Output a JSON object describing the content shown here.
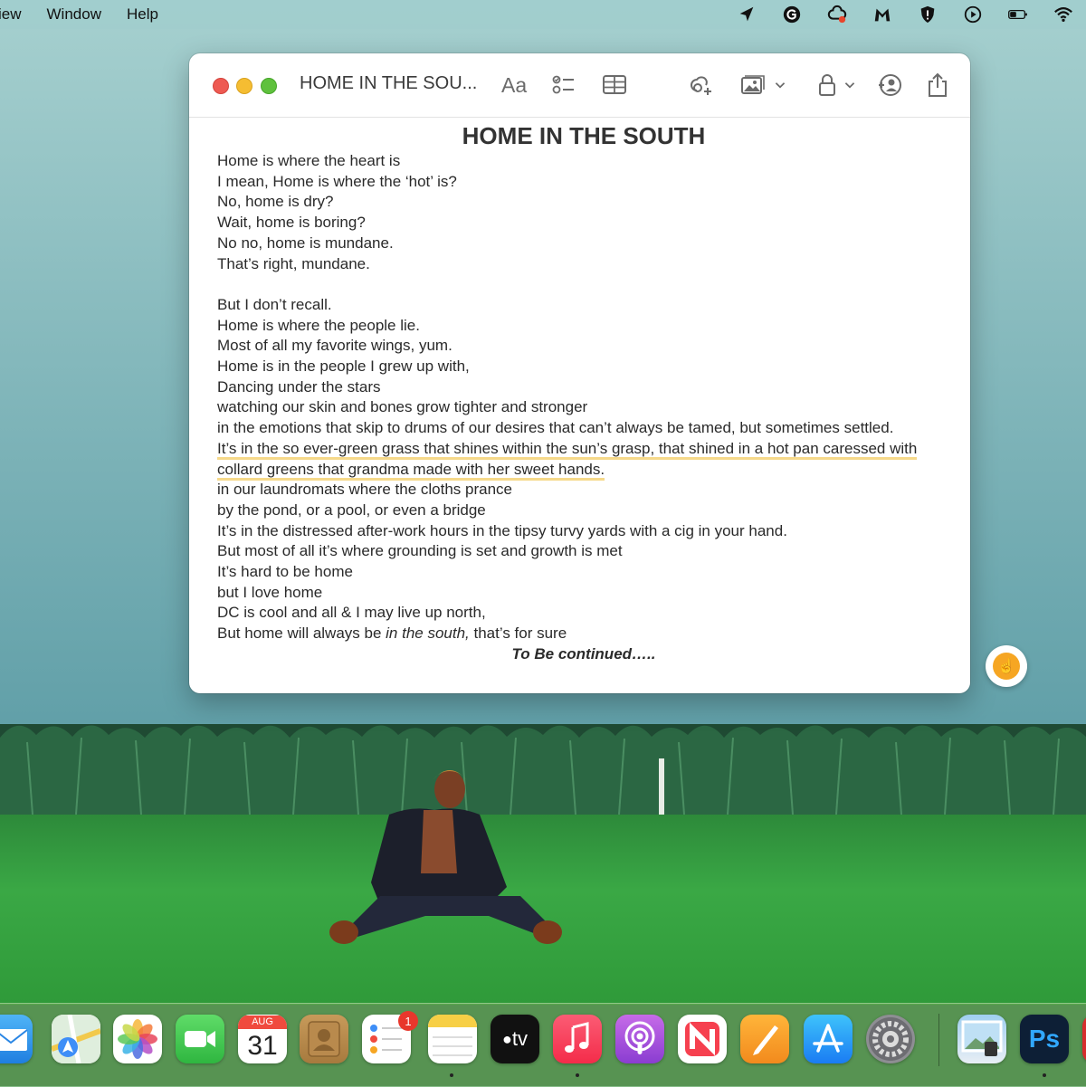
{
  "menubar": {
    "items": [
      "iew",
      "Window",
      "Help"
    ],
    "right_icons": [
      "location-arrow-icon",
      "grammarly-icon",
      "creative-cloud-icon",
      "malwarebytes-icon",
      "shield-icon",
      "play-circle-icon",
      "battery-icon",
      "wifi-icon"
    ]
  },
  "window": {
    "title": "HOME IN THE SOU...",
    "format_label": "Aa",
    "toolbar_icons": [
      "checklist-icon",
      "table-icon",
      "collaborate-icon",
      "media-icon",
      "lock-icon",
      "share-people-icon",
      "share-icon"
    ]
  },
  "note": {
    "heading": "HOME IN THE SOUTH",
    "lines": [
      "Home is where the heart is",
      "I mean, Home is where the ‘hot’ is?",
      "No, home is dry?",
      "Wait, home is boring?",
      "No no, home is mundane.",
      "That’s right, mundane.",
      "",
      "But I don’t recall.",
      "Home is where the people lie.",
      "Most of all my favorite wings, yum.",
      "Home is in the people I grew up with,",
      "Dancing under the stars",
      "watching our skin and bones grow tighter and stronger",
      "in the emotions that skip to drums of our desires that can’t always be tamed, but sometimes settled.",
      "It’s in the so ever-green grass that shines within the sun’s grasp, that shined in a hot pan caressed with collard greens that grandma made with her sweet hands.",
      "in our laundromats where the cloths prance",
      "by the pond, or a pool, or even a bridge",
      "It’s in the distressed after-work hours in the tipsy turvy yards with a cig in your hand.",
      "But most of all it’s where grounding is set and growth is met",
      "It’s hard to be home",
      "but I love home",
      "DC is cool and all & I may live up north,",
      "But home will always be "
    ],
    "italic_phrase": "in the south,",
    "last_line_tail": " that’s for sure",
    "closing": "To Be continued….."
  },
  "dock": {
    "calendar_month": "AUG",
    "calendar_day": "31",
    "reminders_badge": "1",
    "tv_label": "tv",
    "ps_label": "Ps",
    "apps": [
      "mail",
      "maps",
      "photos",
      "facetime",
      "calendar",
      "contacts",
      "reminders",
      "notes",
      "apple-tv",
      "music",
      "podcasts",
      "news",
      "pages",
      "app-store",
      "system-preferences",
      "preview",
      "photoshop"
    ]
  },
  "colors": {
    "highlight": "#f6d98a",
    "close": "#ee5a52",
    "minimize": "#f5bd32",
    "maximize": "#5fc13d"
  }
}
